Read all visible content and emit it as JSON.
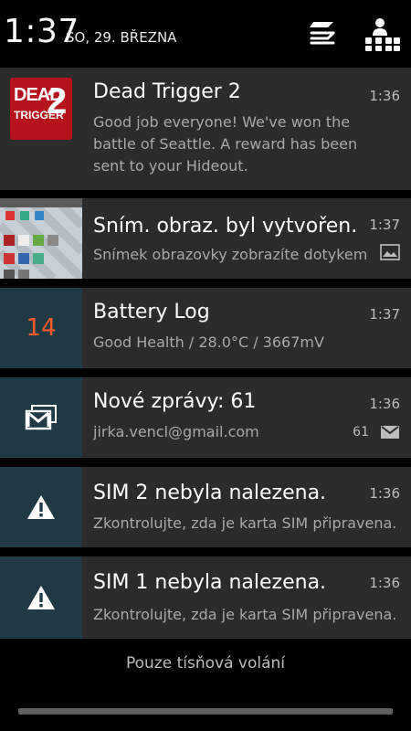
{
  "status": {
    "time": "1:37",
    "date": "SO, 29. BŘEZNA"
  },
  "notifications": [
    {
      "app": "Dead Trigger 2",
      "icon": "dead-trigger-2-logo",
      "icon_text_line1": "DEAD",
      "icon_text_line2": "TRIGGER",
      "icon_text_num": "2",
      "title": "Dead Trigger 2",
      "text_lines": [
        "Good job everyone! We've won the",
        "battle of Seattle. A reward has been",
        "sent to your Hideout."
      ],
      "time": "1:36"
    },
    {
      "app": "Screenshot",
      "icon": "screenshot-thumbnail",
      "title": "Sním. obraz. byl vytvořen.",
      "text": "Snímek obrazovky zobrazíte dotykem.",
      "time": "1:37",
      "small_icon": "picture-icon"
    },
    {
      "app": "Battery Log",
      "icon": "battery-level",
      "icon_value": "14",
      "title": "Battery Log",
      "text": "Good Health / 28.0°C / 3667mV",
      "time": "1:37"
    },
    {
      "app": "Gmail",
      "icon": "gmail-stack-icon",
      "title": "Nové zprávy: 61",
      "text": "jirka.vencl@gmail.com",
      "time": "1:36",
      "count": "61",
      "small_icon": "mail-icon"
    },
    {
      "app": "SIM",
      "icon": "warning-icon",
      "title": "SIM 2 nebyla nalezena.",
      "text": "Zkontrolujte, zda je karta SIM připravena.",
      "time": "1:36"
    },
    {
      "app": "SIM",
      "icon": "warning-icon",
      "title": "SIM 1 nebyla nalezena.",
      "text": "Zkontrolujte, zda je karta SIM připravena.",
      "time": "1:36"
    }
  ],
  "footer": {
    "label": "Pouze tísňová volání"
  },
  "colors": {
    "notification_bg": "#2b2b2b",
    "icon_bg": "#1f3a45",
    "battery_value": "#ff5a2a",
    "dead_trigger_red": "#b5121b"
  }
}
